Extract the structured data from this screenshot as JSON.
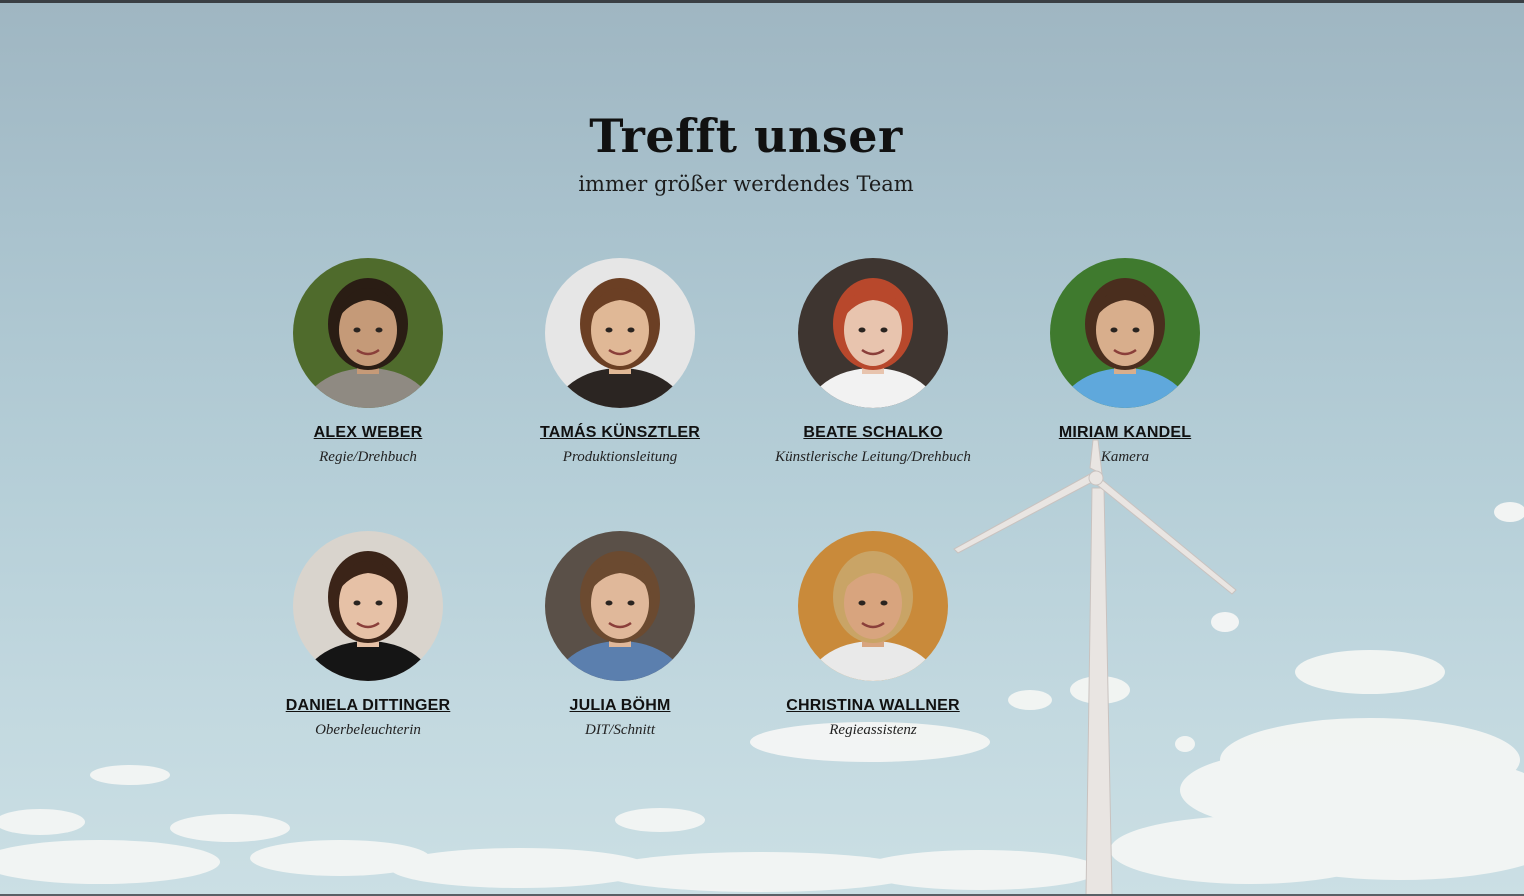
{
  "header": {
    "title": "Trefft unser",
    "subtitle": "immer größer werdendes Team"
  },
  "team": [
    {
      "name": "ALEX WEBER",
      "role": "Regie/Drehbuch",
      "bg": "#4f6b2c",
      "skin": "#c59a78",
      "hair": "#2a1d14",
      "shirt": "#8f8a82"
    },
    {
      "name": "TAMÁS KÜNSZTLER",
      "role": "Produktionsleitung",
      "bg": "#e6e6e6",
      "skin": "#e0b896",
      "hair": "#6b3f24",
      "shirt": "#2b2522"
    },
    {
      "name": "BEATE SCHALKO",
      "role": "Künstlerische Leitung/Drehbuch",
      "bg": "#3e3530",
      "skin": "#e8c4ae",
      "hair": "#b8482c",
      "shirt": "#f2f2f2"
    },
    {
      "name": "MIRIAM KANDEL",
      "role": "Kamera",
      "bg": "#3f7a2e",
      "skin": "#d8ae8c",
      "hair": "#4a2e1e",
      "shirt": "#5fa8dc"
    },
    {
      "name": "DANIELA DITTINGER",
      "role": "Oberbeleuchterin",
      "bg": "#d9d4cd",
      "skin": "#e6c1a6",
      "hair": "#3b2418",
      "shirt": "#151515"
    },
    {
      "name": "JULIA BÖHM",
      "role": "DIT/Schnitt",
      "bg": "#5a5048",
      "skin": "#e0b89a",
      "hair": "#6b4a30",
      "shirt": "#5b7fae"
    },
    {
      "name": "CHRISTINA WALLNER",
      "role": "Regieassistenz",
      "bg": "#c98a3a",
      "skin": "#d8a47e",
      "hair": "#c9a466",
      "shirt": "#e9e9e9"
    }
  ]
}
